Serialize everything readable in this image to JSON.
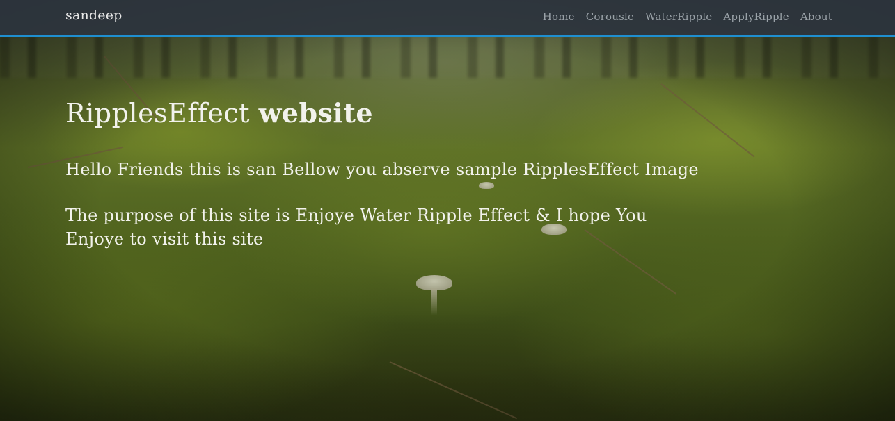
{
  "navbar": {
    "brand": "sandeep",
    "items": [
      {
        "label": "Home"
      },
      {
        "label": "Corousle"
      },
      {
        "label": "WaterRipple"
      },
      {
        "label": "ApplyRipple"
      },
      {
        "label": "About"
      }
    ],
    "accent_color": "#1f8fd0"
  },
  "hero": {
    "title_regular": "RipplesEffect",
    "title_bold": "website",
    "paragraph1": "Hello Friends this is san Bellow you abserve sample RipplesEffect Image",
    "paragraph2": "The purpose of this site is Enjoye Water Ripple Effect & I hope You Enjoye to visit this site"
  }
}
